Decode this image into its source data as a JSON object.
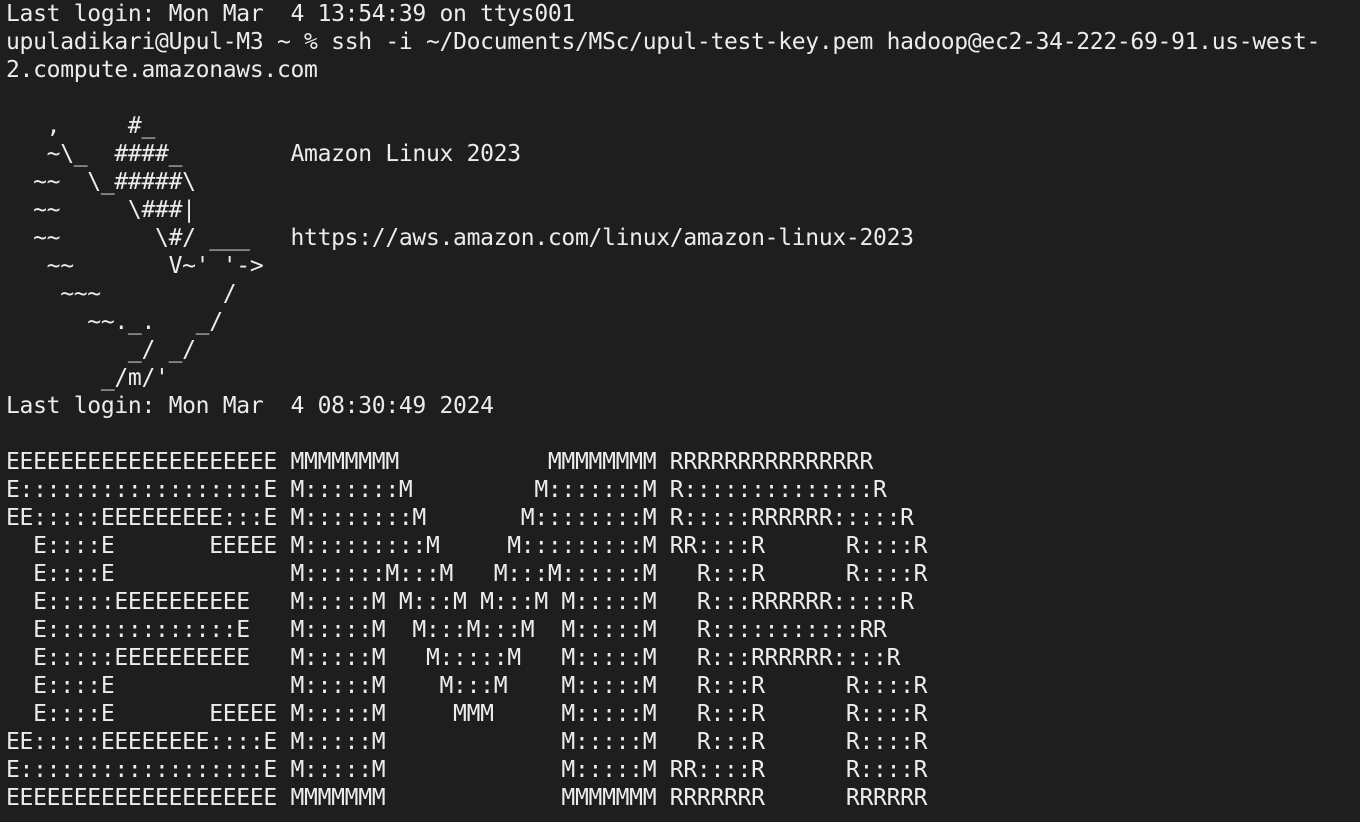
{
  "terminal": {
    "colors": {
      "background": "#1e1e1e",
      "foreground": "#ececec"
    },
    "last_login_local": "Last login: Mon Mar  4 13:54:39 on ttys001",
    "prompt": "upuladikari@Upul-M3 ~ % ",
    "command": "ssh -i ~/Documents/MSc/upul-test-key.pem hadoop@ec2-34-222-69-91.us-west-",
    "command_wrap": "2.compute.amazonaws.com",
    "blank": "",
    "motd": {
      "rows": [
        "   ,     #_",
        "   ~\\_  ####_        Amazon Linux 2023",
        "  ~~  \\_#####\\",
        "  ~~     \\###|",
        "  ~~       \\#/ ___   https://aws.amazon.com/linux/amazon-linux-2023",
        "   ~~       V~' '->",
        "    ~~~         /",
        "      ~~._.   _/",
        "         _/ _/",
        "       _/m/'"
      ],
      "os_name": "Amazon Linux 2023",
      "os_url": "https://aws.amazon.com/linux/amazon-linux-2023"
    },
    "last_login_remote": "Last login: Mon Mar  4 08:30:49 2024",
    "emr_banner": [
      "EEEEEEEEEEEEEEEEEEEE MMMMMMMM           MMMMMMMM RRRRRRRRRRRRRRR",
      "E::::::::::::::::::E M:::::::M         M:::::::M R::::::::::::::R",
      "EE:::::EEEEEEEEE:::E M::::::::M       M::::::::M R:::::RRRRRR:::::R",
      "  E::::E       EEEEE M:::::::::M     M:::::::::M RR::::R      R::::R",
      "  E::::E             M::::::M:::M   M:::M::::::M   R:::R      R::::R",
      "  E:::::EEEEEEEEEE   M:::::M M:::M M:::M M:::::M   R:::RRRRRR:::::R",
      "  E::::::::::::::E   M:::::M  M:::M:::M  M:::::M   R:::::::::::RR",
      "  E:::::EEEEEEEEEE   M:::::M   M:::::M   M:::::M   R:::RRRRRR::::R",
      "  E::::E             M:::::M    M:::M    M:::::M   R:::R      R::::R",
      "  E::::E       EEEEE M:::::M     MMM     M:::::M   R:::R      R::::R",
      "EE:::::EEEEEEEE::::E M:::::M             M:::::M   R:::R      R::::R",
      "E::::::::::::::::::E M:::::M             M:::::M RR::::R      R::::R",
      "EEEEEEEEEEEEEEEEEEEE MMMMMMM             MMMMMMM RRRRRRR      RRRRRR"
    ]
  }
}
